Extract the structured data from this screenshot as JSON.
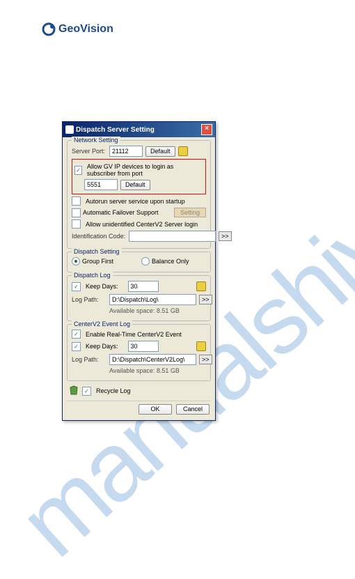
{
  "brand": {
    "name": "GeoVision"
  },
  "watermark": "manualshive.com",
  "dialog": {
    "title": "Dispatch Server Setting",
    "network": {
      "legend": "Network Setting",
      "server_port_label": "Server Port:",
      "server_port_value": "21112",
      "default_btn": "Default",
      "allow_gv_label": "Allow GV IP devices to login as subscriber from port",
      "allow_gv_value": "5551",
      "autorun_label": "Autorun server service upon startup",
      "failover_label": "Automatic Failover Support",
      "setting_btn": "Setting",
      "allow_unident_label": "Allow unidentified CenterV2 Server login",
      "ident_code_label": "Identification Code:",
      "ident_code_value": ""
    },
    "dispatch": {
      "legend": "Dispatch Setting",
      "group_first": "Group First",
      "balance_only": "Balance Only"
    },
    "dispatchlog": {
      "legend": "Dispatch Log",
      "keep_days_label": "Keep Days:",
      "keep_days_value": "30",
      "log_path_label": "Log Path:",
      "log_path_value": "D:\\Dispatch\\Log\\",
      "avail_space": "Available space: 8.51 GB"
    },
    "centerv2log": {
      "legend": "CenterV2 Event Log",
      "enable_label": "Enable Real-Time CenterV2 Event",
      "keep_days_label": "Keep Days:",
      "keep_days_value": "30",
      "log_path_label": "Log Path:",
      "log_path_value": "D:\\Dispatch\\CenterV2Log\\",
      "avail_space": "Available space: 8.51 GB"
    },
    "recycle_label": "Recycle Log",
    "ok": "OK",
    "cancel": "Cancel",
    "browse": ">>"
  }
}
